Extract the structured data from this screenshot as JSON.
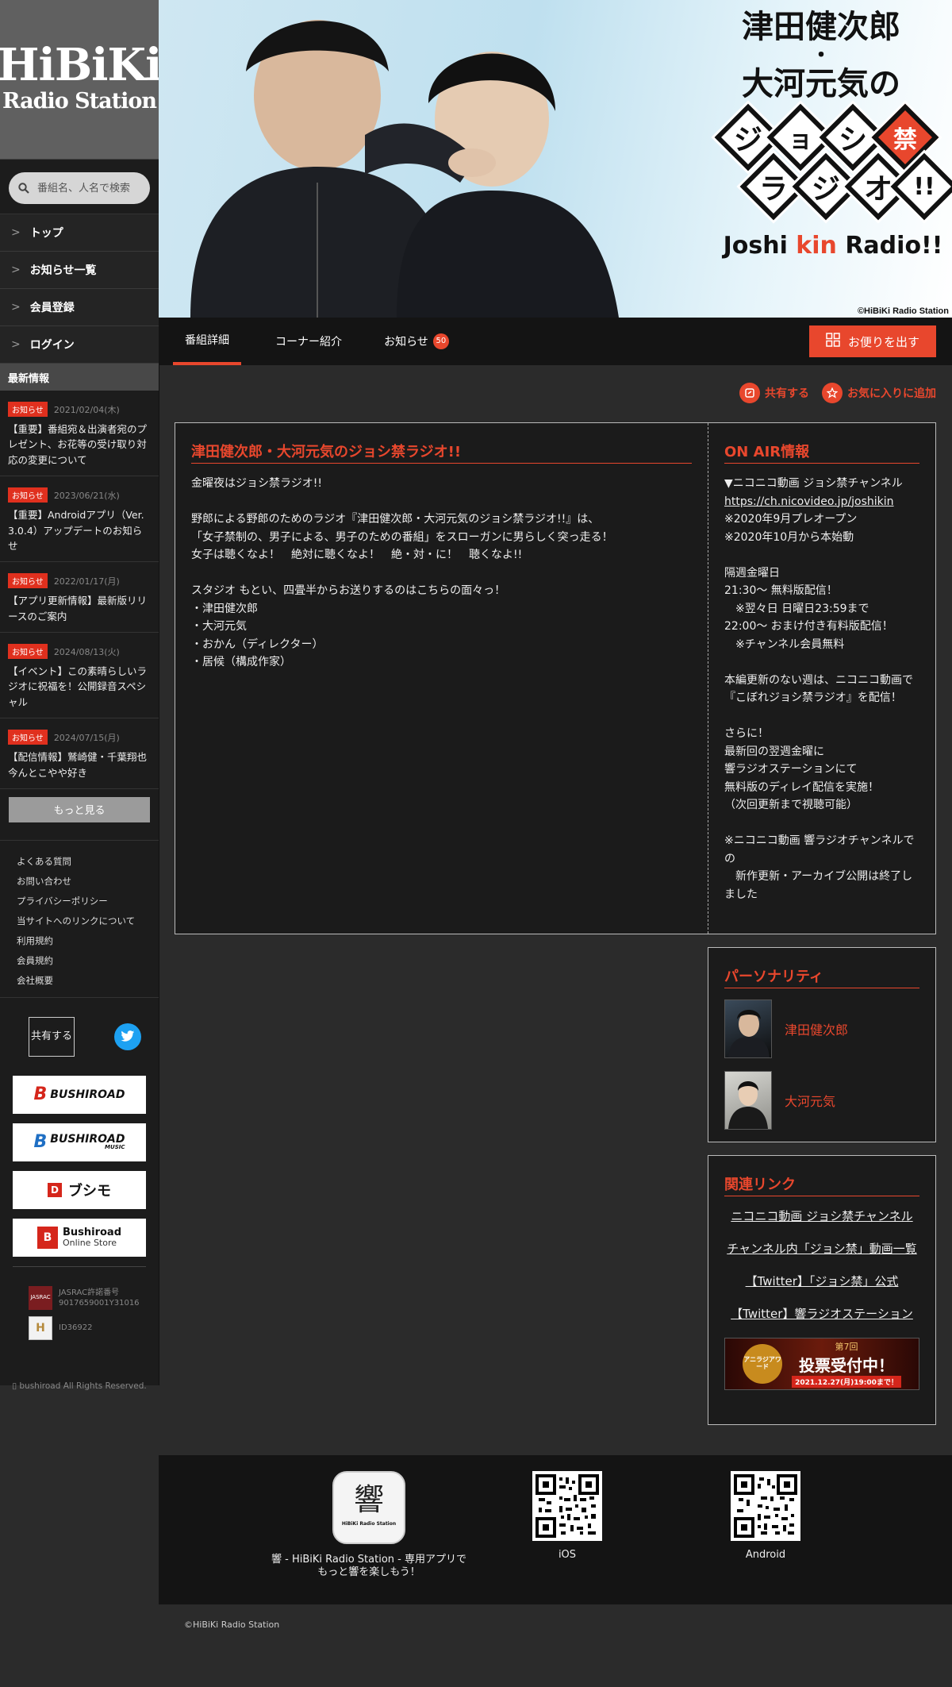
{
  "brand": {
    "logo_main": "HiBiKi",
    "logo_sub": "Radio Station"
  },
  "search": {
    "placeholder": "番組名、人名で検索"
  },
  "nav": [
    {
      "label": "トップ"
    },
    {
      "label": "お知らせ一覧"
    },
    {
      "label": "会員登録"
    },
    {
      "label": "ログイン"
    }
  ],
  "news": {
    "heading": "最新情報",
    "items": [
      {
        "badge": "お知らせ",
        "date": "2021/02/04(木)",
        "title": "【重要】番組宛＆出演者宛のプレゼント、お花等の受け取り対応の変更について"
      },
      {
        "badge": "お知らせ",
        "date": "2023/06/21(水)",
        "title": "【重要】Androidアプリ（Ver. 3.0.4）アップデートのお知らせ"
      },
      {
        "badge": "お知らせ",
        "date": "2022/01/17(月)",
        "title": "【アプリ更新情報】最新版リリースのご案内"
      },
      {
        "badge": "お知らせ",
        "date": "2024/08/13(火)",
        "title": "【イベント】この素晴らしいラジオに祝福を！公開録音スペシャル"
      },
      {
        "badge": "お知らせ",
        "date": "2024/07/15(月)",
        "title": "【配信情報】鷲崎健・千葉翔也 今んとこやや好き"
      }
    ],
    "more": "もっと見る"
  },
  "footer_links": [
    "よくある質問",
    "お問い合わせ",
    "プライバシーポリシー",
    "当サイトへのリンクについて",
    "利用規約",
    "会員規約",
    "会社概要"
  ],
  "share": {
    "label": "共有する"
  },
  "banners": [
    {
      "text": "BUSHIROAD"
    },
    {
      "text": "BUSHIROAD",
      "sub": "MUSIC"
    },
    {
      "text": "ブシモ"
    },
    {
      "text": "Bushiroad",
      "sub": "Online Store"
    }
  ],
  "jasrac": {
    "line1": "JASRAC許諾番号",
    "line2": "9017659001Y31016",
    "icon_text": "JASRAC"
  },
  "idnum": {
    "text": "ID36922"
  },
  "side_copyright": " bushiroad All Rights Reserved.",
  "hero": {
    "title_line1": "津田健次郎",
    "dot": "・",
    "title_line2": "大河元気の",
    "diamonds": [
      "ジ",
      "ョ",
      "シ",
      "禁",
      "ラ",
      "ジ",
      "オ",
      "!!"
    ],
    "en_pre": "Joshi ",
    "en_kin": "kin",
    "en_post": " Radio!!",
    "credit": "©HiBiKi Radio Station",
    "colors": {
      "accent": "#e8472d",
      "diamond_fill": "#ffffff",
      "diamond_border": "#111111"
    }
  },
  "tabs": [
    {
      "label": "番組詳細"
    },
    {
      "label": "コーナー紹介"
    },
    {
      "label": "お知らせ",
      "count": "50"
    }
  ],
  "letter_button": "お便りを出す",
  "actions": {
    "share": "共有する",
    "favorite": "お気に入りに追加"
  },
  "program": {
    "title": "津田健次郎・大河元気のジョシ禁ラジオ!!",
    "description": "金曜夜はジョシ禁ラジオ!!\n\n野郎による野郎のためのラジオ『津田健次郎・大河元気のジョシ禁ラジオ!!』は、\n「女子禁制の、男子による、男子のための番組」をスローガンに男らしく突っ走る！\n女子は聴くなよ！　絶対に聴くなよ！　絶・対・に！　聴くなよ!!\n\nスタジオ もとい、四畳半からお送りするのはこちらの面々っ！\n・津田健次郎\n・大河元気\n・おかん（ディレクター）\n・居候（構成作家）"
  },
  "on_air": {
    "title": "ON AIR情報",
    "line1": "▼ニコニコ動画 ジョシ禁チャンネル",
    "url": "https://ch.nicovideo.jp/joshikin",
    "rest": "※2020年9月プレオープン\n※2020年10月から本始動\n\n隔週金曜日\n21:30〜 無料版配信！\n　※翌々日 日曜日23:59まで\n22:00〜 おまけ付き有料版配信！\n　※チャンネル会員無料\n\n本編更新のない週は、ニコニコ動画で\n『こぼれジョシ禁ラジオ』を配信！\n\nさらに！\n最新回の翌週金曜に\n響ラジオステーションにて\n無料版のディレイ配信を実施！\n（次回更新まで視聴可能）\n\n※ニコニコ動画 響ラジオチャンネルでの\n　新作更新・アーカイブ公開は終了しました"
  },
  "personality": {
    "title": "パーソナリティ",
    "people": [
      {
        "name": "津田健次郎"
      },
      {
        "name": "大河元気"
      }
    ]
  },
  "related": {
    "title": "関連リンク",
    "links": [
      "ニコニコ動画 ジョシ禁チャンネル",
      "チャンネル内「ジョシ禁」動画一覧",
      "【Twitter】「ジョシ禁」公式",
      "【Twitter】響ラジオステーション"
    ],
    "banner": {
      "logo": "アニラジアワード",
      "edition": "第7回",
      "headline": "投票受付中！",
      "deadline": "2021.12.27(月)19:00まで！"
    }
  },
  "app": {
    "description": "響 - HiBiKi Radio Station - 専用アプリで\nもっと響を楽しもう！",
    "ios": " iOS",
    "android": " Android",
    "icon_text": "HiBiKi Radio Station"
  },
  "copyright": "©HiBiKi Radio Station"
}
